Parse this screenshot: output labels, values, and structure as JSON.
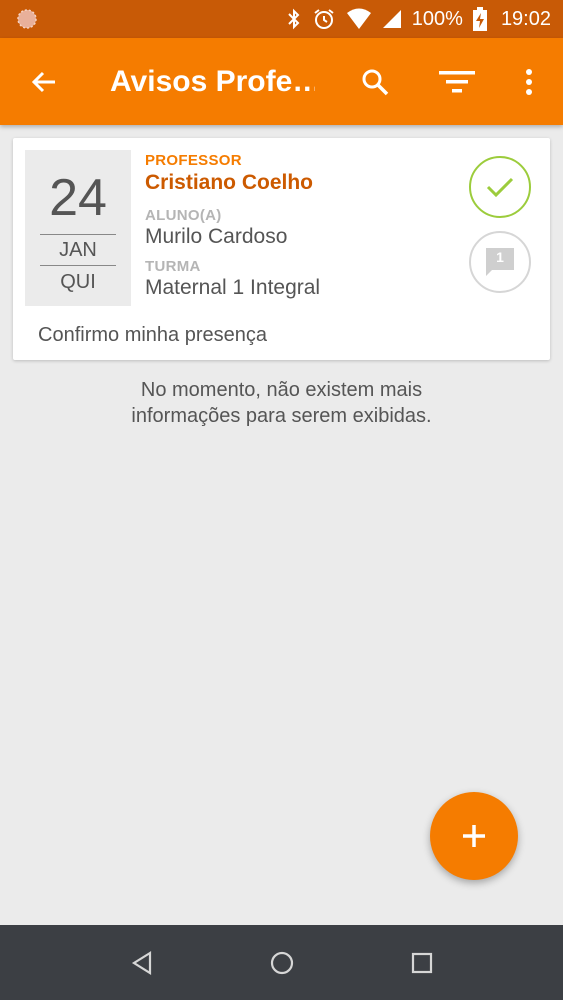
{
  "status_bar": {
    "battery": "100%",
    "time": "19:02"
  },
  "app_bar": {
    "title": "Avisos Profe…"
  },
  "card": {
    "date": {
      "day": "24",
      "month": "JAN",
      "weekday": "QUI"
    },
    "professor_label": "PROFESSOR",
    "professor_name": "Cristiano Coelho",
    "student_label": "ALUNO(A)",
    "student_name": "Murilo Cardoso",
    "class_label": "TURMA",
    "class_name": "Maternal 1 Integral",
    "comment_count": "1",
    "message": "Confirmo minha presença"
  },
  "empty_note": {
    "line1": "No momento, não existem mais",
    "line2": "informações para serem exibidas."
  },
  "colors": {
    "app_bar": "#f57c00",
    "status_bar": "#c85a06",
    "accent_text": "#cc5a00",
    "check": "#9ccc3c",
    "nav_bar": "#3c3f44"
  },
  "icons": [
    "app-notification-icon",
    "bluetooth-icon",
    "alarm-icon",
    "wifi-icon",
    "signal-icon",
    "battery-charging-icon",
    "back-arrow-icon",
    "search-icon",
    "filter-icon",
    "more-vert-icon",
    "check-icon",
    "comment-icon",
    "plus-icon",
    "nav-back-icon",
    "nav-home-icon",
    "nav-recents-icon"
  ]
}
